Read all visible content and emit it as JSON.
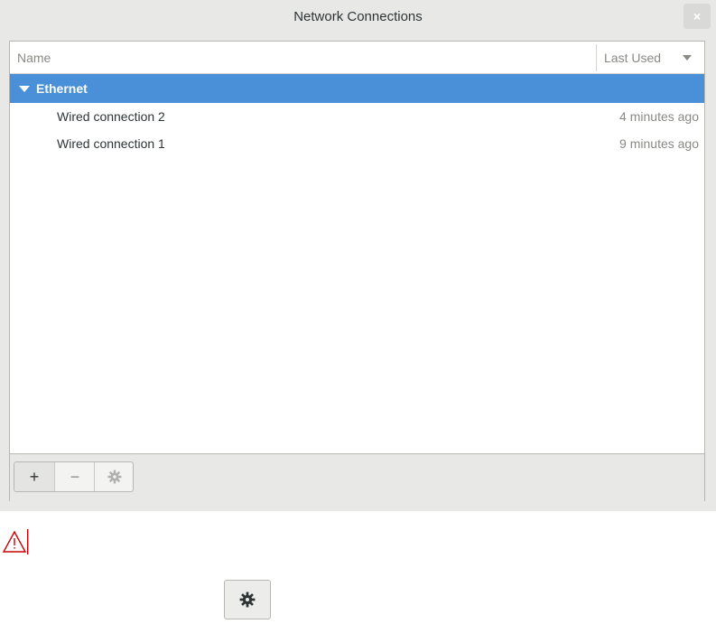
{
  "window": {
    "title": "Network Connections",
    "close_label": "×"
  },
  "list": {
    "columns": {
      "name": "Name",
      "last_used": "Last Used"
    },
    "groups": [
      {
        "label": "Ethernet",
        "expanded": true,
        "selected": true,
        "connections": [
          {
            "name": "Wired connection 2",
            "last_used": "4 minutes ago"
          },
          {
            "name": "Wired connection 1",
            "last_used": "9 minutes ago"
          }
        ]
      }
    ]
  },
  "toolbar": {
    "add_label": "+",
    "remove_label": "−",
    "settings_icon": "gear-icon"
  },
  "colors": {
    "selection": "#4a90d9",
    "window_bg": "#e8e8e7",
    "warning": "#cc0000"
  },
  "icons": {
    "warning": "warning-triangle-icon",
    "bottom_button": "gear-icon"
  }
}
